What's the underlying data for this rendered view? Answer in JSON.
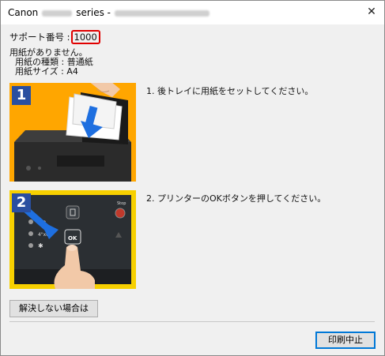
{
  "window": {
    "title_prefix": "Canon",
    "title_suffix": "series -"
  },
  "support": {
    "label": "サポート番号 :",
    "code": "1000"
  },
  "message": {
    "line1": "用紙がありません。",
    "line2": "用紙の種類 : 普通紙",
    "line3": "用紙サイズ : A4"
  },
  "steps": [
    {
      "badge": "1",
      "text": "1.  後トレイに用紙をセットしてください。"
    },
    {
      "badge": "2",
      "text": "2.  プリンターのOKボタンを押してください。"
    }
  ],
  "panel2": {
    "labels": [
      "LTR",
      "4\"x6\"",
      "Stop",
      "OK"
    ]
  },
  "buttons": {
    "help": "解決しない場合は",
    "cancel": "印刷中止"
  },
  "colors": {
    "highlight": "#e00000",
    "badge": "#2a4fa0",
    "arrow": "#1e6fe0"
  }
}
